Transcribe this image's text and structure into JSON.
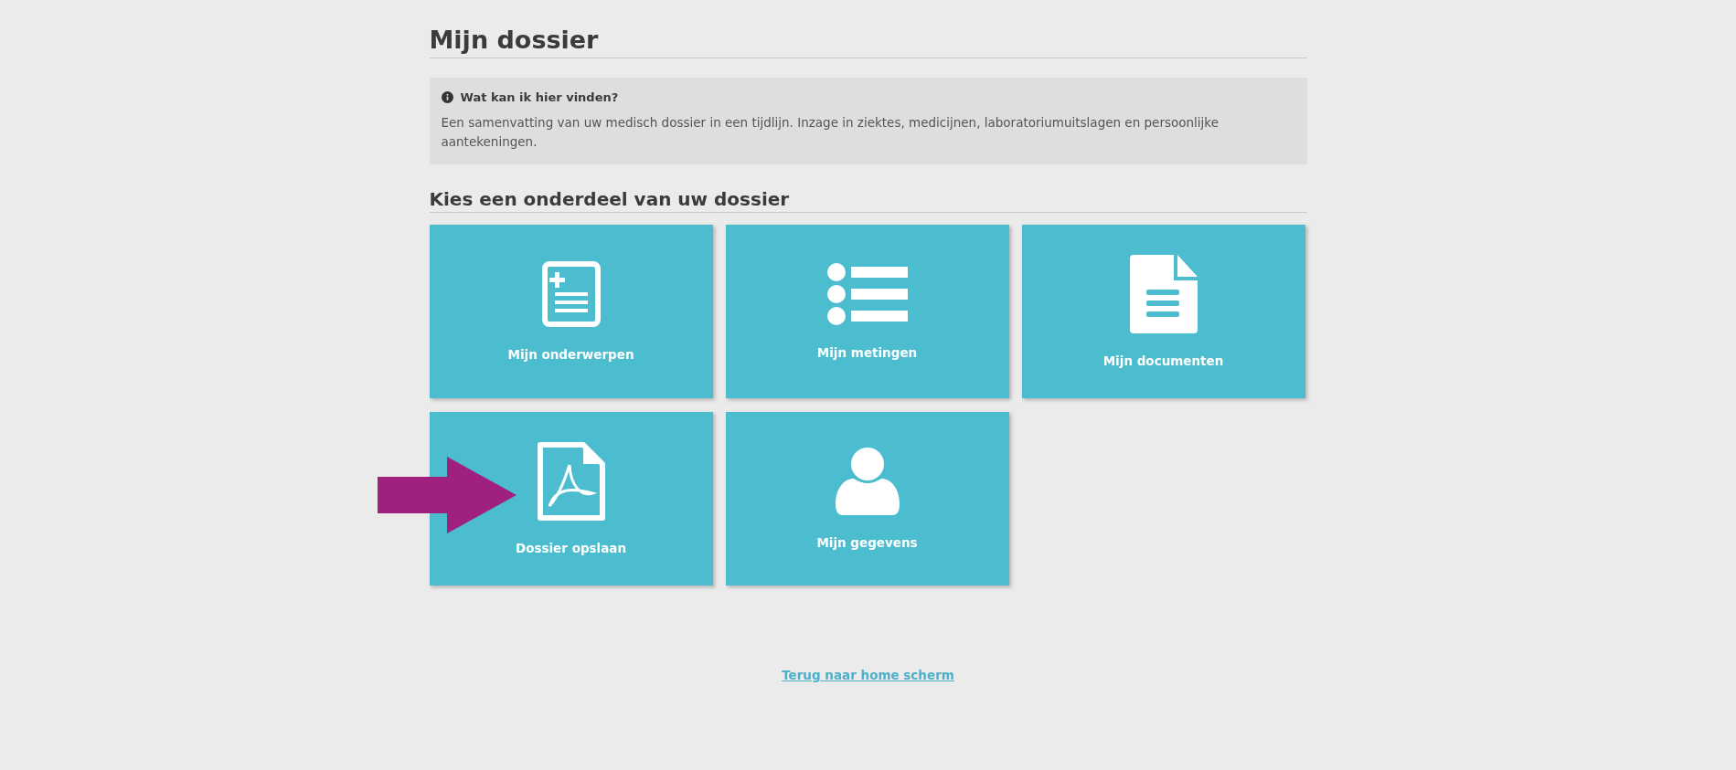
{
  "title": "Mijn dossier",
  "info": {
    "heading": "Wat kan ik hier vinden?",
    "text": "Een samenvatting van uw medisch dossier in een tijdlijn. Inzage in ziektes, medicijnen, laboratoriumuitslagen en persoonlijke aantekeningen."
  },
  "section_title": "Kies een onderdeel van uw dossier",
  "tiles": [
    {
      "kind": "record",
      "label": "Mijn onderwerpen"
    },
    {
      "kind": "list",
      "label": "Mijn metingen"
    },
    {
      "kind": "document",
      "label": "Mijn documenten"
    },
    {
      "kind": "pdf",
      "label": "Dossier opslaan"
    },
    {
      "kind": "person",
      "label": "Mijn gegevens"
    }
  ],
  "back_link": "Terug naar home scherm"
}
